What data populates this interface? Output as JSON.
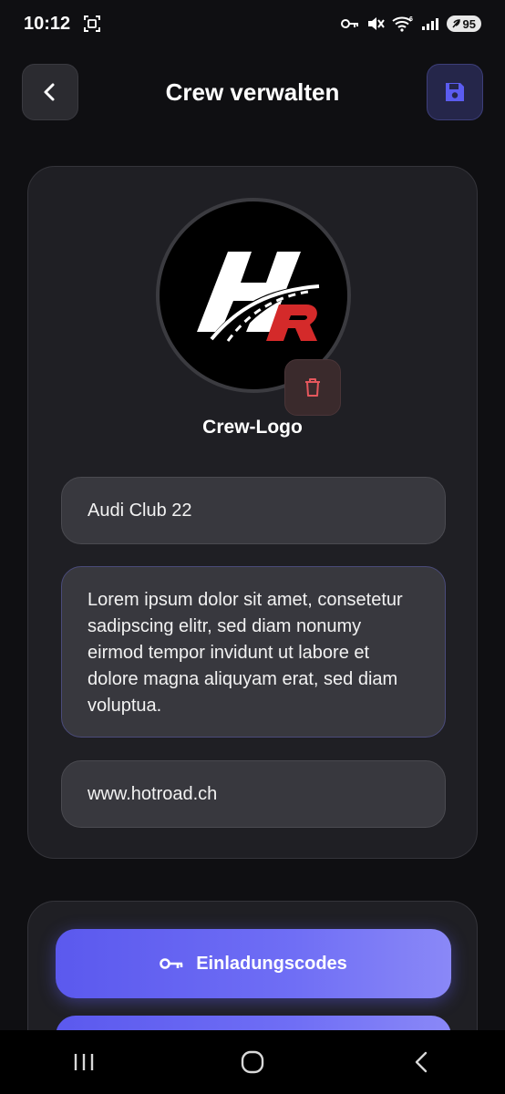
{
  "status_bar": {
    "time": "10:12",
    "battery": "95",
    "signal_badge": "6"
  },
  "header": {
    "title": "Crew verwalten",
    "back_icon": "chevron-left-icon",
    "save_icon": "floppy-disk-icon"
  },
  "crew": {
    "logo_label": "Crew-Logo",
    "logo_text": "HR",
    "name": "Audi Club 22",
    "description": "Lorem ipsum dolor sit amet, consetetur sadipscing elitr, sed diam nonumy eirmod tempor invidunt ut labore et dolore magna aliquyam erat, sed diam voluptua.",
    "website": "www.hotroad.ch"
  },
  "actions": {
    "invite_codes_label": "Einladungscodes",
    "invite_icon": "key-icon"
  },
  "colors": {
    "background": "#0f0f12",
    "card": "#1f1f24",
    "accent": "#6664f2",
    "danger": "#e5575d",
    "logo_red": "#d42a2a"
  }
}
